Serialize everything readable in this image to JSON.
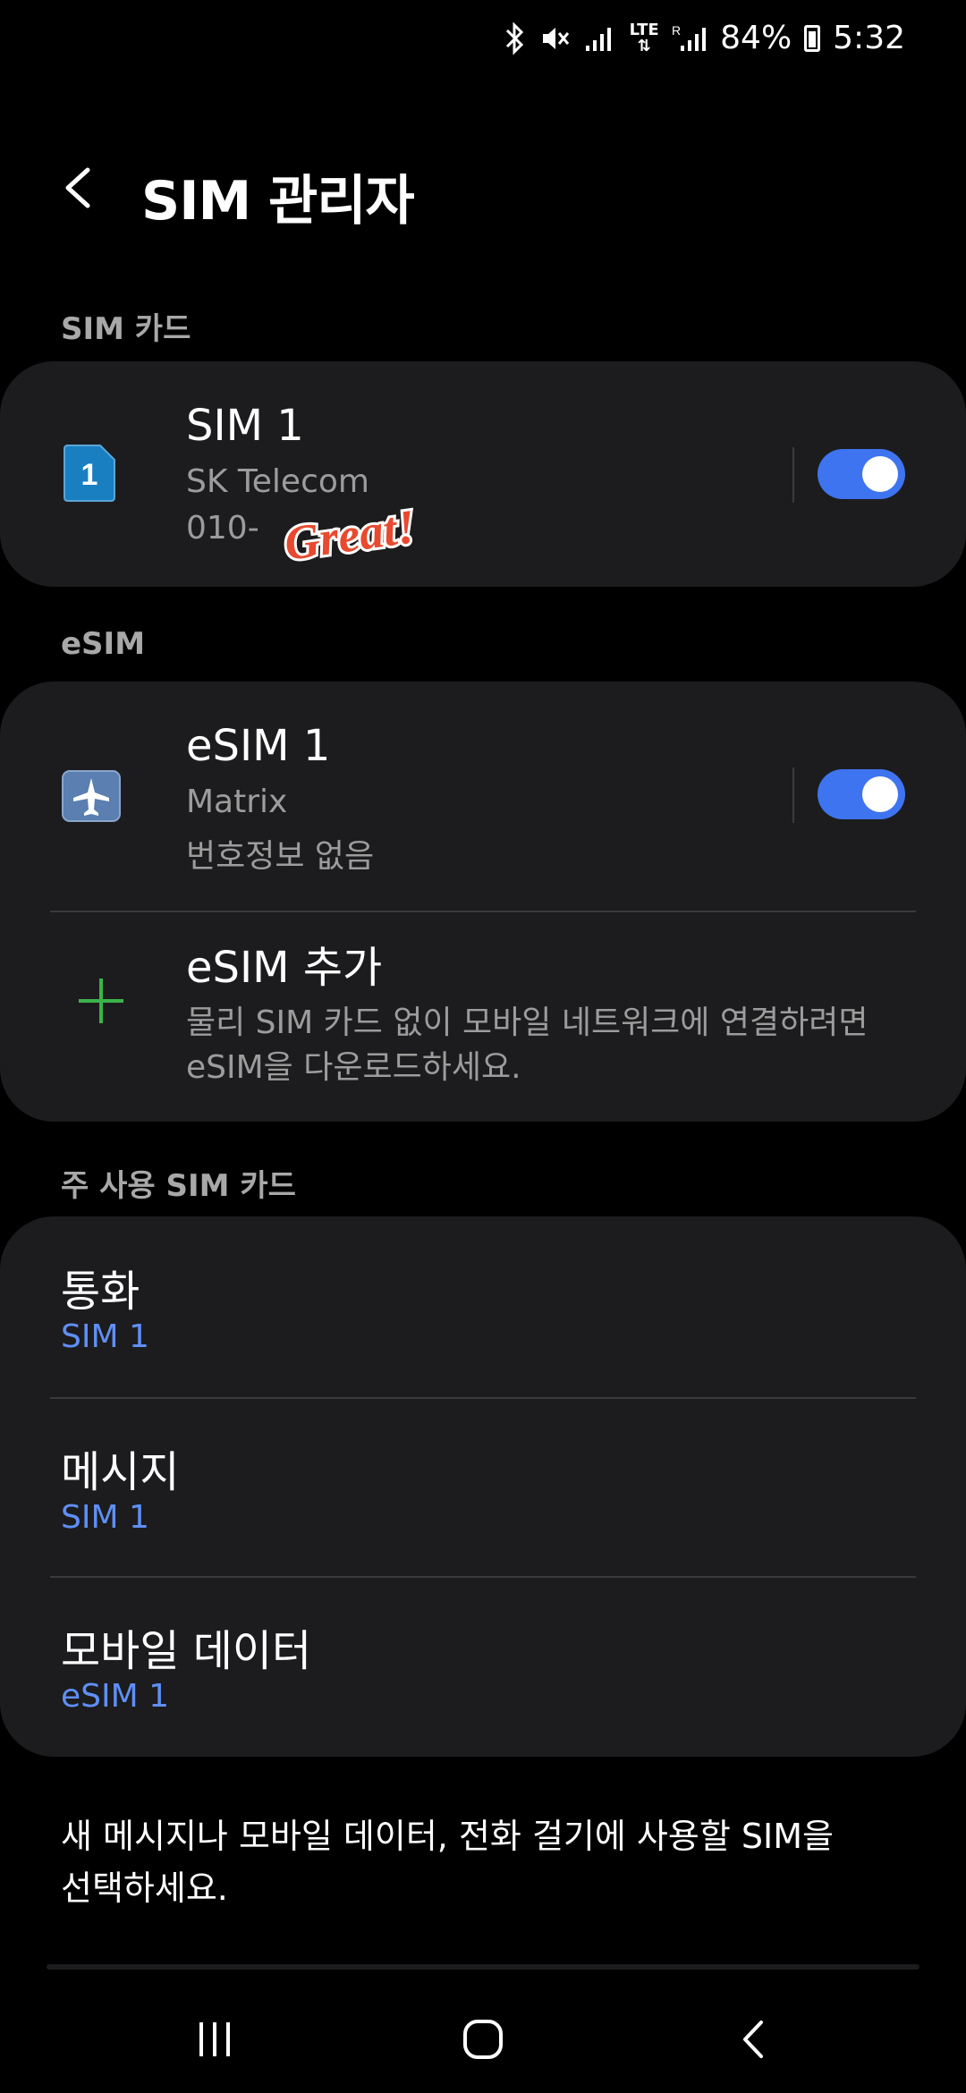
{
  "status_bar": {
    "battery_percent": "84%",
    "time": "5:32",
    "icons": [
      "bluetooth-icon",
      "mute-icon",
      "signal-icon",
      "lte-icon",
      "signal-r-icon",
      "battery-icon"
    ],
    "lte_label": "LTE"
  },
  "appbar": {
    "title": "SIM 관리자",
    "back_icon": "back-chevron-icon"
  },
  "sections": {
    "sim_cards_header": "SIM 카드",
    "esim_header": "eSIM",
    "primary_sim_header": "주 사용 SIM 카드"
  },
  "sim_card": {
    "title": "SIM 1",
    "carrier": "SK Telecom",
    "number": "010-",
    "icon_label": "1",
    "toggle_on": true,
    "sticker_text": "Great!"
  },
  "esim_card": {
    "title": "eSIM 1",
    "carrier": "Matrix",
    "number": "번호정보 없음",
    "icon": "airplane-icon",
    "toggle_on": true
  },
  "add_esim": {
    "title": "eSIM 추가",
    "description_line1": "물리 SIM 카드 없이 모바일 네트워크에 연결하려면",
    "description_line2": "eSIM을 다운로드하세요."
  },
  "primary_sim": {
    "calls_label": "통화",
    "calls_value": "SIM 1",
    "messages_label": "메시지",
    "messages_value": "SIM 1",
    "mobile_data_label": "모바일 데이터",
    "mobile_data_value": "eSIM 1"
  },
  "footnote": {
    "line1": "새 메시지나 모바일 데이터, 전화 걸기에 사용할 SIM을",
    "line2": "선택하세요."
  },
  "nav_bar": {
    "icons": [
      "recent-apps-icon",
      "home-icon",
      "back-icon"
    ]
  },
  "colors": {
    "background": "#000000",
    "card": "#1c1c1e",
    "accent_blue": "#3e74f0",
    "link_blue": "#5f8ff5",
    "sim_icon_blue": "#1a7fc1",
    "plus_green": "#3bb34a",
    "sticker_red": "#e8492f"
  }
}
